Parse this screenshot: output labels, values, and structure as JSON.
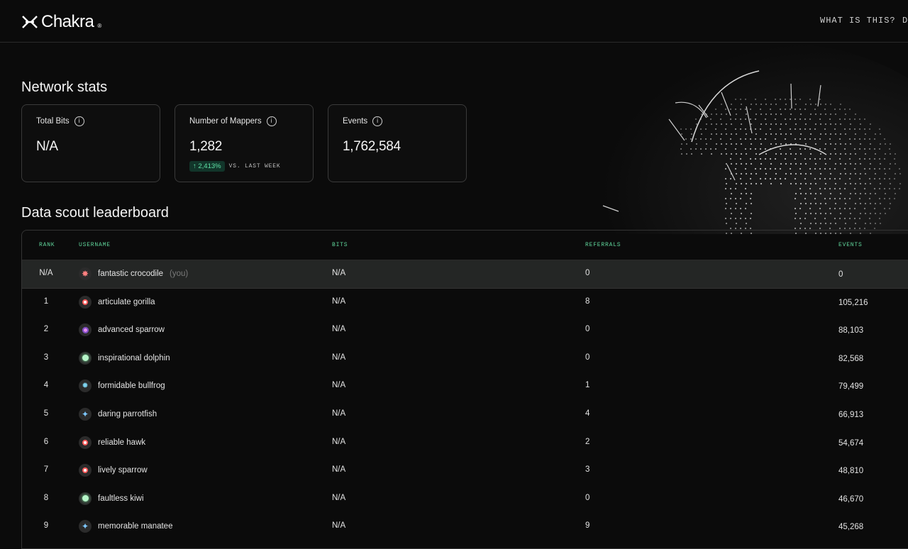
{
  "brand": {
    "name": "Chakra",
    "reg": "®"
  },
  "nav": [
    {
      "label": "WHAT IS THIS?"
    },
    {
      "label": "D"
    }
  ],
  "stats": {
    "title": "Network stats",
    "cards": [
      {
        "label": "Total Bits",
        "value": "N/A"
      },
      {
        "label": "Number of Mappers",
        "value": "1,282",
        "trend": "↑ 2,413%",
        "trend_label": "VS. LAST WEEK"
      },
      {
        "label": "Events",
        "value": "1,762,584"
      }
    ]
  },
  "leaderboard": {
    "title": "Data scout leaderboard",
    "columns": {
      "rank": "RANK",
      "username": "USERNAME",
      "bits": "BITS",
      "referrals": "REFERRALS",
      "events": "EVENTS"
    },
    "you_suffix": "(you)",
    "rows": [
      {
        "rank": "N/A",
        "username": "fantastic crocodile",
        "avatar": "star-avatar-icon",
        "bits": "N/A",
        "referrals": "0",
        "events": "0",
        "is_you": true
      },
      {
        "rank": "1",
        "username": "articulate gorilla",
        "avatar": "ring-avatar-icon",
        "bits": "N/A",
        "referrals": "8",
        "events": "105,216"
      },
      {
        "rank": "2",
        "username": "advanced sparrow",
        "avatar": "flower-avatar-icon",
        "bits": "N/A",
        "referrals": "0",
        "events": "88,103"
      },
      {
        "rank": "3",
        "username": "inspirational dolphin",
        "avatar": "green-orb-avatar-icon",
        "bits": "N/A",
        "referrals": "0",
        "events": "82,568"
      },
      {
        "rank": "4",
        "username": "formidable bullfrog",
        "avatar": "gear-avatar-icon",
        "bits": "N/A",
        "referrals": "1",
        "events": "79,499"
      },
      {
        "rank": "5",
        "username": "daring parrotfish",
        "avatar": "spark-avatar-icon",
        "bits": "N/A",
        "referrals": "4",
        "events": "66,913"
      },
      {
        "rank": "6",
        "username": "reliable hawk",
        "avatar": "ring-avatar-icon",
        "bits": "N/A",
        "referrals": "2",
        "events": "54,674"
      },
      {
        "rank": "7",
        "username": "lively sparrow",
        "avatar": "ring-avatar-icon",
        "bits": "N/A",
        "referrals": "3",
        "events": "48,810"
      },
      {
        "rank": "8",
        "username": "faultless kiwi",
        "avatar": "green-orb-avatar-icon",
        "bits": "N/A",
        "referrals": "0",
        "events": "46,670"
      },
      {
        "rank": "9",
        "username": "memorable manatee",
        "avatar": "spark-avatar-icon",
        "bits": "N/A",
        "referrals": "9",
        "events": "45,268"
      }
    ]
  }
}
